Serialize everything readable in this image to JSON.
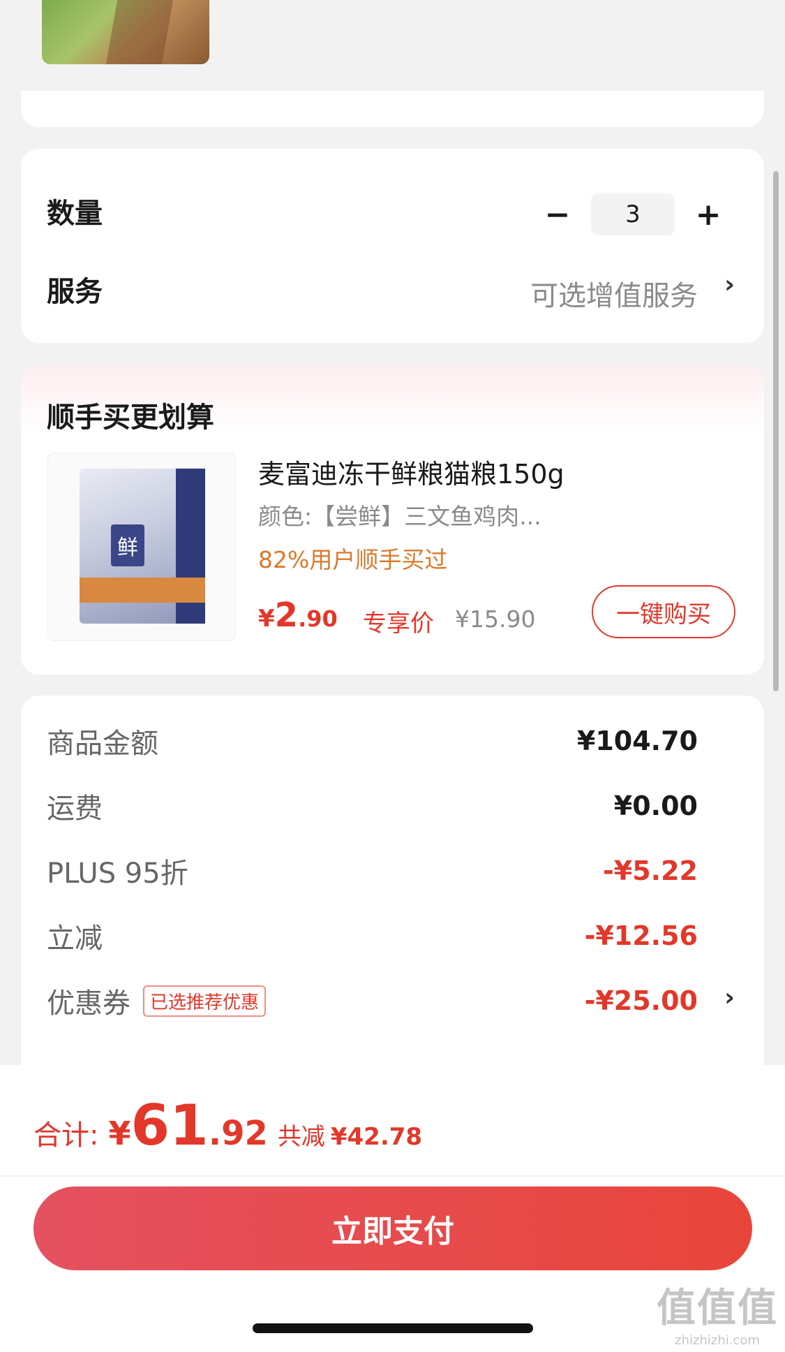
{
  "quantity": {
    "label": "数量",
    "value": "3",
    "minus": "−",
    "plus": "+"
  },
  "service": {
    "label": "服务",
    "value": "可选增值服务",
    "chevron": "›"
  },
  "recommend": {
    "title": "顺手买更划算",
    "product": {
      "name": "麦富迪冻干鲜粮猫粮150g",
      "spec": "颜色:【尝鲜】三文鱼鸡肉...",
      "buyers": "82%用户顺手买过",
      "price_symbol": "¥",
      "price_int": "2",
      "price_dec": ".90",
      "price_tag": "专享价",
      "original_price": "¥15.90",
      "bag_mark": "鲜",
      "buy_label": "一键购买"
    }
  },
  "amounts": {
    "rows": [
      {
        "label": "商品金额",
        "value": "¥104.70"
      },
      {
        "label": "运费",
        "value": "¥0.00"
      },
      {
        "label": "PLUS 95折",
        "value": "-¥5.22"
      },
      {
        "label": "立减",
        "value": "-¥12.56"
      },
      {
        "label": "优惠券",
        "badge": "已选推荐优惠",
        "value": "-¥25.00",
        "chevron": "›"
      }
    ]
  },
  "total": {
    "label": "合计:",
    "symbol": "¥",
    "int": "61",
    "dec": ".92",
    "saved_label": "共减",
    "saved_value": "¥42.78"
  },
  "pay_button": "立即支付",
  "watermark": {
    "big": "值值值",
    "small": "zhizhizhi.com"
  },
  "colors": {
    "accent": "#e2382a",
    "orange": "#d97a2c",
    "muted": "#8a8a8a"
  }
}
